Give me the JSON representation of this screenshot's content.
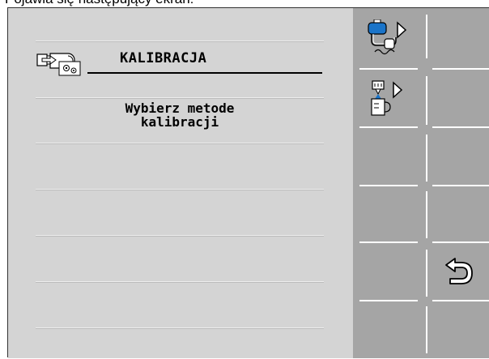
{
  "caption": "Pojawia się następujący ekran:",
  "screen": {
    "title": "KALIBRACJA",
    "message_line1": "Wybierz metode",
    "message_line2": "kalibracji"
  },
  "softkeys": [
    {
      "id": "calibrate-tank-pump",
      "icon": "tank-pump-arrow-icon"
    },
    {
      "id": "calibrate-nozzle-jug",
      "icon": "nozzle-jug-arrow-icon"
    },
    {
      "id": "back",
      "icon": "back-arrow-icon"
    }
  ],
  "colors": {
    "screen_bg": "#d4d4d4",
    "softkey_bar_bg": "#a5a5a5",
    "divider": "#ffffff",
    "tank_blue": "#1a74c9"
  }
}
